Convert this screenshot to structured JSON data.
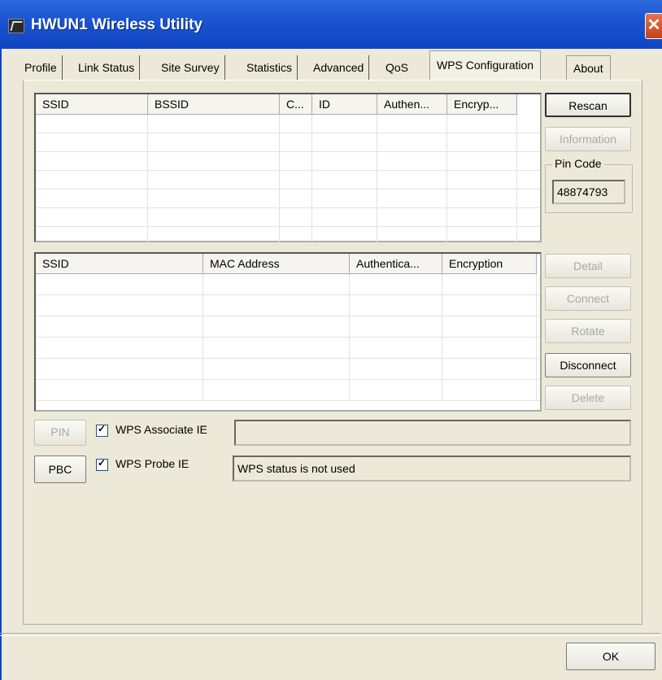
{
  "window": {
    "title": "HWUN1 Wireless Utility",
    "close_glyph": "✕"
  },
  "tabs": [
    "Profile",
    "Link Status",
    "Site Survey",
    "Statistics",
    "Advanced",
    "QoS",
    "WPS Configuration",
    "About"
  ],
  "active_tab": "WPS Configuration",
  "ap_list": {
    "columns": [
      "SSID",
      "BSSID",
      "C...",
      "ID",
      "Authen...",
      "Encryp..."
    ],
    "rows": []
  },
  "profile_list": {
    "columns": [
      "SSID",
      "MAC Address",
      "Authentica...",
      "Encryption"
    ],
    "rows": []
  },
  "buttons": {
    "rescan": "Rescan",
    "information": "Information",
    "detail": "Detail",
    "connect": "Connect",
    "rotate": "Rotate",
    "disconnect": "Disconnect",
    "delete": "Delete",
    "pin": "PIN",
    "pbc": "PBC",
    "ok": "OK"
  },
  "pin_code": {
    "label": "Pin Code",
    "value": "48874793"
  },
  "options": {
    "wps_associate_ie": {
      "label": "WPS Associate IE",
      "checked": true
    },
    "wps_probe_ie": {
      "label": "WPS Probe IE",
      "checked": true
    }
  },
  "status": {
    "text": "WPS status is not used"
  },
  "colors": {
    "titlebar": "#1b54d0",
    "close": "#d2552a",
    "background": "#ece9d8"
  }
}
